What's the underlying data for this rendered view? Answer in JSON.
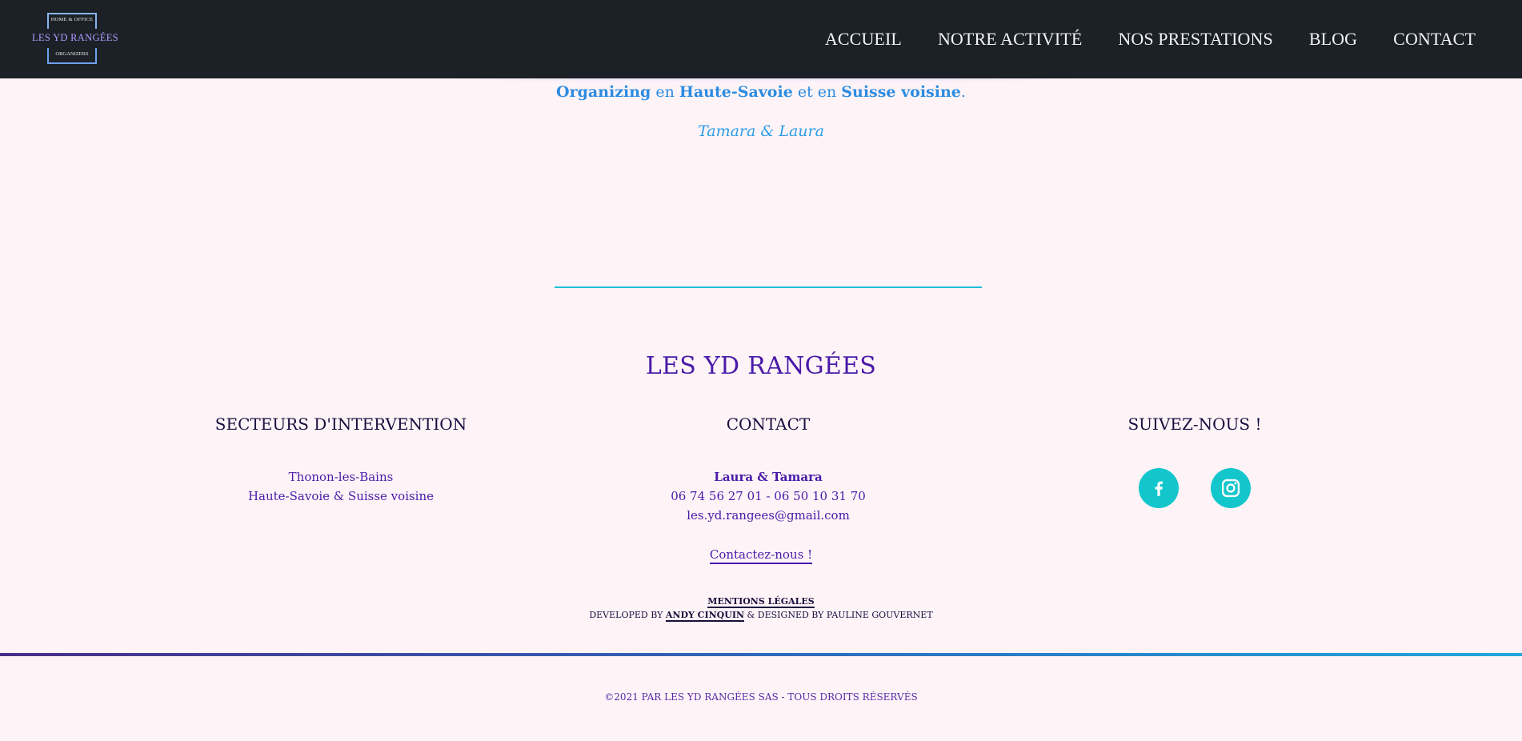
{
  "header": {
    "logo": {
      "top_text": "HOME & OFFICE",
      "main_text": "LES YD RANGÉES",
      "bottom_text": "ORGANIZERS"
    },
    "nav": [
      "ACCUEIL",
      "NOTRE ACTIVITÉ",
      "NOS PRESTATIONS",
      "BLOG",
      "CONTACT"
    ]
  },
  "intro": {
    "word1": "Organizing",
    "word2": " en ",
    "word3": "Haute-Savoie",
    "word4": " et en ",
    "word5": "Suisse voisine",
    "word6": ".",
    "signature": "Tamara & Laura"
  },
  "footer": {
    "brand": "LES YD RANGÉES",
    "sectors": {
      "heading": "SECTEURS D'INTERVENTION",
      "line1": "Thonon-les-Bains",
      "line2": "Haute-Savoie & Suisse voisine"
    },
    "contact": {
      "heading": "CONTACT",
      "names": "Laura & Tamara",
      "phones": "06 74 56 27 01  -  06 50 10 31 70",
      "email": "les.yd.rangees@gmail.com",
      "link": "Contactez-nous !"
    },
    "follow": {
      "heading": "SUIVEZ-NOUS !",
      "icons": [
        "facebook-icon",
        "instagram-icon"
      ]
    },
    "mentions": "MENTIONS LÉGALES",
    "credits": {
      "prefix": "DEVELOPED BY ",
      "developer": "ANDY CINQUIN",
      "suffix": " & DESIGNED BY PAULINE GOUVERNET"
    },
    "copyright": "©2021 PAR LES YD RANGÉES SAS - TOUS DROITS RÉSERVÉS"
  },
  "colors": {
    "header_bg": "#1b2126",
    "page_bg": "#fef4f8",
    "accent_blue": "#2d8ce0",
    "brand_purple": "#4a1aa8",
    "divider": "#22bfd6",
    "social_bg": "#13c6cc"
  }
}
